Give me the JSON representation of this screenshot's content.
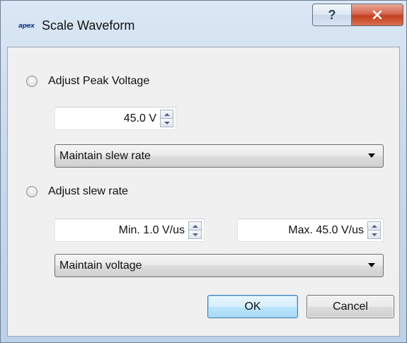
{
  "window": {
    "title": "Scale Waveform",
    "app_logo_text": "apex",
    "help_glyph": "?",
    "close_icon": "close-icon"
  },
  "peak": {
    "label": "Adjust Peak Voltage",
    "selected": false,
    "voltage_value": "45.0 V",
    "mode_select": "Maintain slew rate"
  },
  "slew": {
    "label": "Adjust slew rate",
    "selected": false,
    "min_value": "Min. 1.0 V/us",
    "max_value": "Max. 45.0 V/us",
    "mode_select": "Maintain voltage"
  },
  "buttons": {
    "ok": "OK",
    "cancel": "Cancel"
  }
}
